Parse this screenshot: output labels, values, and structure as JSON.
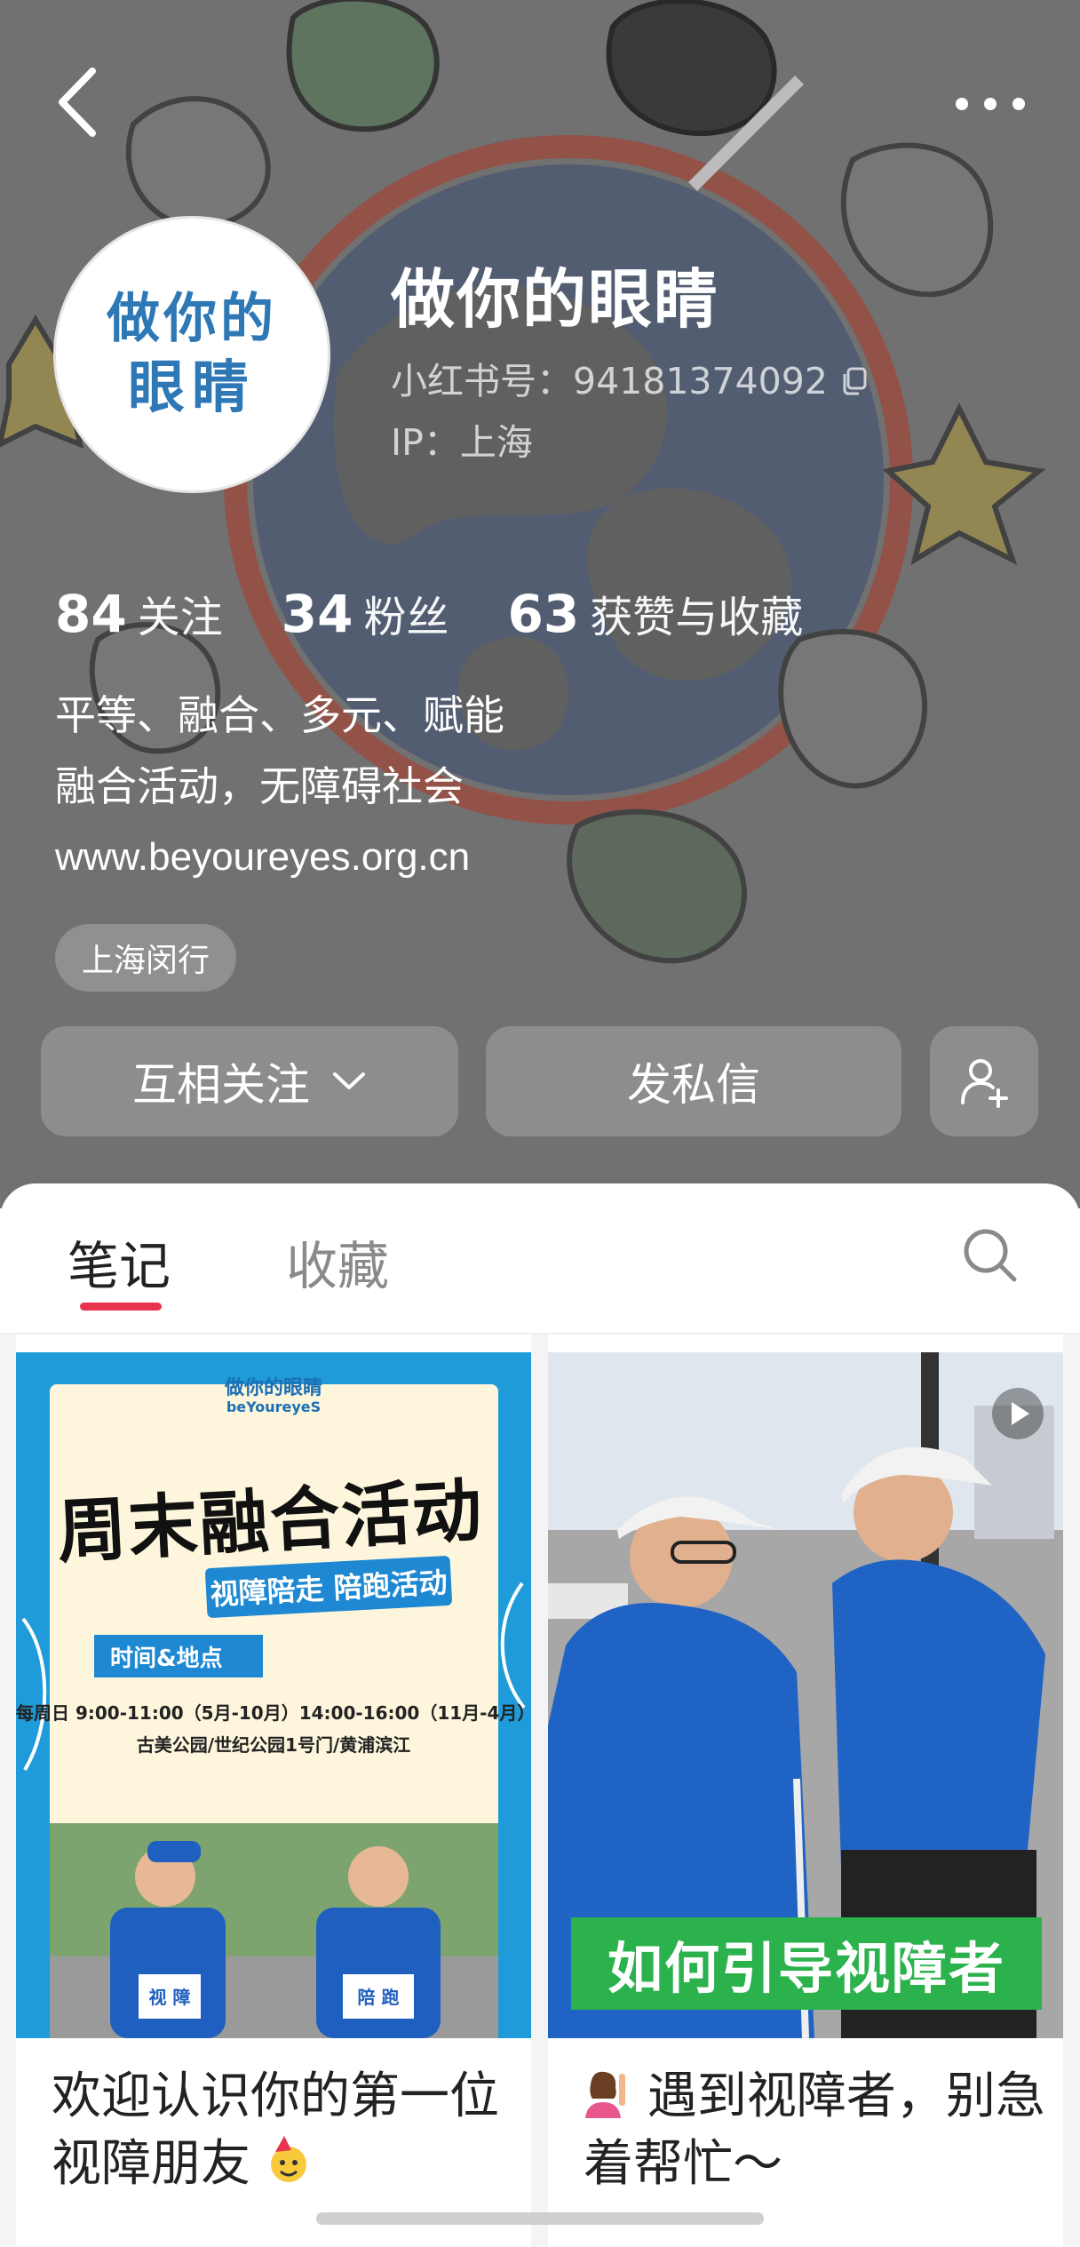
{
  "header": {
    "back_icon": "chevron-left-icon",
    "more_icon": "more-horizontal-icon"
  },
  "profile": {
    "avatar_text_line1": "做你的",
    "avatar_text_line2": "眼睛",
    "name": "做你的眼睛",
    "red_id": "小红书号：94181374092",
    "copy_icon": "copy-icon",
    "ip": "IP：上海",
    "stats": [
      {
        "count": "84",
        "label": "关注"
      },
      {
        "count": "34",
        "label": "粉丝"
      },
      {
        "count": "63",
        "label": "获赞与收藏"
      }
    ],
    "bio_lines": [
      "平等、融合、多元、赋能",
      "融合活动，无障碍社会"
    ],
    "website": "www.beyoureyes.org.cn",
    "location_tag": "上海闵行"
  },
  "actions": {
    "follow_label": "互相关注",
    "message_label": "发私信",
    "add_user_icon": "add-user-icon"
  },
  "tabs": {
    "items": [
      "笔记",
      "收藏"
    ],
    "active": "笔记",
    "search_icon": "search-icon",
    "accent_color": "#e8344f"
  },
  "notes": [
    {
      "title": "欢迎认识你的第一位视障朋友",
      "emoji": "party-face-icon",
      "poster": {
        "brand": "做你的眼睛",
        "brand_en": "beYoureyeS",
        "headline": "周末融合活动",
        "subline": "视障陪走 陪跑活动",
        "time_tag": "时间&地点",
        "schedule": "每周日 9:00-11:00（5月-10月）14:00-16:00（11月-4月）",
        "venues": "古美公园/世纪公园1号门/黄浦滨江",
        "bib_left": "视 障",
        "bib_right": "陪 跑"
      }
    },
    {
      "title": "遇到视障者，别急着帮忙～",
      "emoji": "person-raising-hand-icon",
      "banner": "如何引导视障者",
      "video_icon": "play-icon"
    }
  ]
}
